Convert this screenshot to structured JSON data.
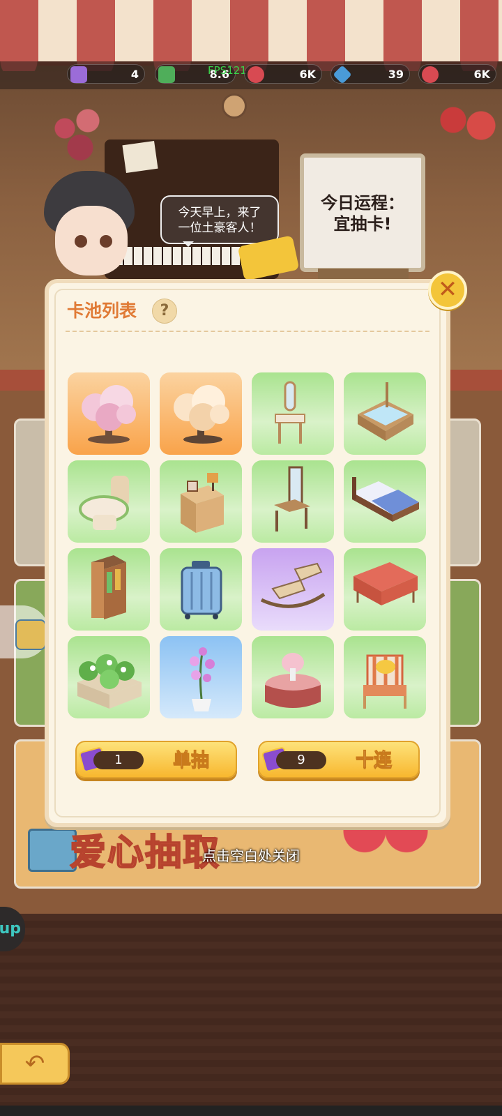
{
  "status_bar": {
    "fps": "FPS121",
    "resources": [
      {
        "name": "ticket",
        "value": "4",
        "icon": "ticket-icon",
        "color": "#9b6cd8"
      },
      {
        "name": "cash",
        "value": "8.6",
        "icon": "cash-icon",
        "color": "#4fae5a"
      },
      {
        "name": "heart",
        "value": "6K",
        "icon": "heart-icon",
        "color": "#d84a52"
      },
      {
        "name": "diamond",
        "value": "39",
        "icon": "diamond-icon",
        "color": "#4a9bd8"
      },
      {
        "name": "heart2",
        "value": "6K",
        "icon": "heart-icon",
        "color": "#d84a52"
      }
    ]
  },
  "scene": {
    "speech_bubble": "今天早上，来了一位土豪客人！",
    "speech_line1": "今天早上，来了",
    "speech_line2": "一位土豪客人！",
    "sign_line1": "今日运程：",
    "sign_line2": "宜抽卡!",
    "banner_text": "爱心抽取",
    "side_up_label": "up"
  },
  "modal": {
    "title": "卡池列表",
    "help_symbol": "?",
    "close_symbol": "✕",
    "items": [
      {
        "name": "pink-blossom-tree",
        "bg": "orange"
      },
      {
        "name": "cream-blossom-tree",
        "bg": "orange"
      },
      {
        "name": "vanity-mirror-stand",
        "bg": "green"
      },
      {
        "name": "wooden-bathtub",
        "bg": "green"
      },
      {
        "name": "toilet",
        "bg": "green"
      },
      {
        "name": "nightstand-lamp",
        "bg": "green"
      },
      {
        "name": "dressing-table",
        "bg": "green"
      },
      {
        "name": "double-bed",
        "bg": "green"
      },
      {
        "name": "wardrobe",
        "bg": "green"
      },
      {
        "name": "blue-suitcase",
        "bg": "green"
      },
      {
        "name": "rocking-chair",
        "bg": "purple"
      },
      {
        "name": "red-sofa",
        "bg": "green"
      },
      {
        "name": "flower-planter",
        "bg": "green"
      },
      {
        "name": "orchid-pot",
        "bg": "blue"
      },
      {
        "name": "round-flower-table",
        "bg": "green"
      },
      {
        "name": "striped-armchair",
        "bg": "green"
      }
    ],
    "single_draw": {
      "count": "1",
      "label": "单抽"
    },
    "ten_draw": {
      "count": "9",
      "label": "十连"
    }
  },
  "close_hint": "点击空白处关闭",
  "back_symbol": "↶"
}
